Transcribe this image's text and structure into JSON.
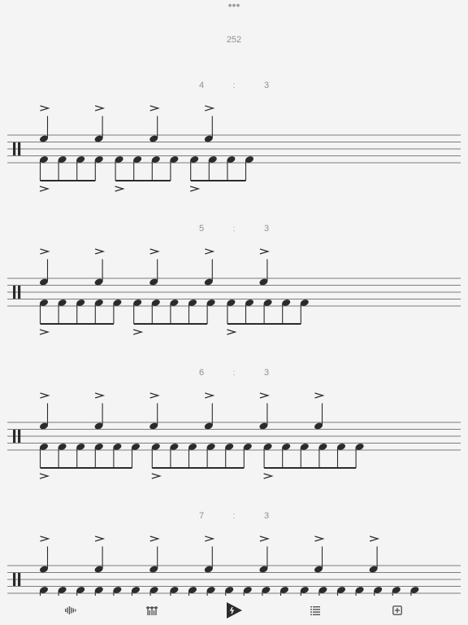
{
  "app": {
    "more_icon": "ellipsis-icon",
    "tempo": "252"
  },
  "colors": {
    "background": "#f4f4f4",
    "ink": "#2b2b2b",
    "staff_line": "#555555",
    "label": "#8f8f8f"
  },
  "exercises": [
    {
      "top_count": "4",
      "separator": ":",
      "bottom_count": "3",
      "top_notes": 4,
      "bottom_notes": 12,
      "group_size": 4
    },
    {
      "top_count": "5",
      "separator": ":",
      "bottom_count": "3",
      "top_notes": 5,
      "bottom_notes": 15,
      "group_size": 5
    },
    {
      "top_count": "6",
      "separator": ":",
      "bottom_count": "3",
      "top_notes": 6,
      "bottom_notes": 18,
      "group_size": 6
    },
    {
      "top_count": "7",
      "separator": ":",
      "bottom_count": "3",
      "top_notes": 7,
      "bottom_notes": 21,
      "group_size": 7
    }
  ],
  "toolbar": [
    {
      "name": "sound-wave-icon"
    },
    {
      "name": "metronome-settings-icon"
    },
    {
      "name": "play-icon"
    },
    {
      "name": "list-icon"
    },
    {
      "name": "add-icon"
    }
  ]
}
